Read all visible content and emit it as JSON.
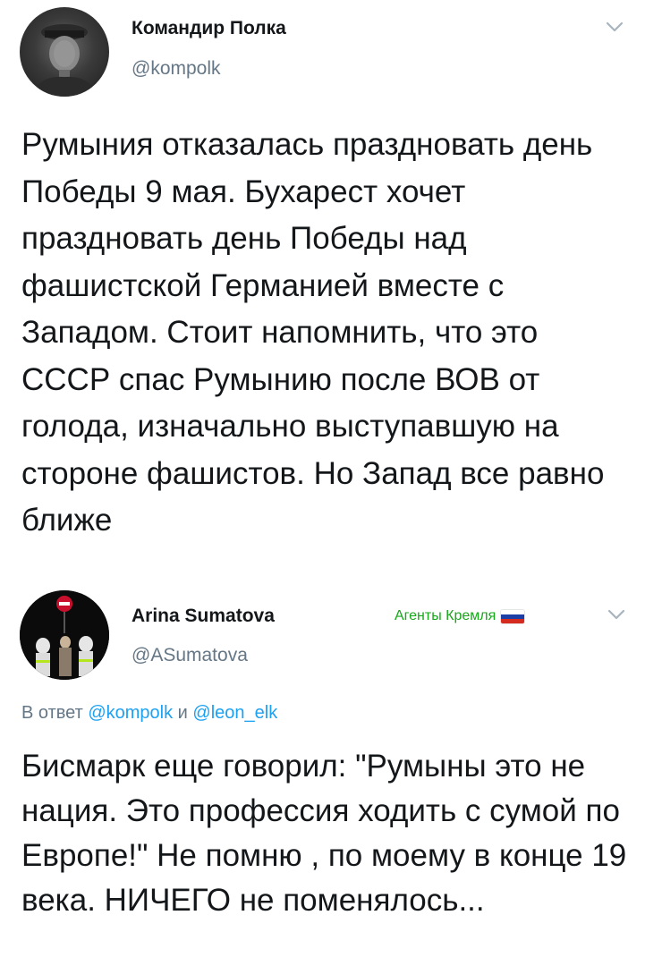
{
  "tweets": [
    {
      "display_name": "Командир Полка",
      "handle": "@kompolk",
      "avatar_icon": "profile-photo",
      "menu_icon": "chevron-down-icon",
      "text": "Румыния отказалась праздновать день Победы 9 мая. Бухарест хочет праздновать день Победы над фашистской Германией вместе с Западом. Стоит напомнить, что это СССР спас Румынию после ВОВ от голода, изначально выступавшую на стороне фашистов. Но Запад все равно ближе"
    },
    {
      "display_name": "Arina Sumatova",
      "handle": "@ASumatova",
      "avatar_icon": "profile-photo",
      "menu_icon": "chevron-down-icon",
      "label": "Агенты Кремля",
      "label_flag": "russian-flag-icon",
      "reply_prefix": "В ответ",
      "reply_user_1": "@kompolk",
      "reply_and": "и",
      "reply_user_2": "@leon_elk",
      "text": "Бисмарк еще говорил: \"Румыны это не нация. Это профессия ходить с сумой по Европе!\" Не помню , по моему в конце 19 века. НИЧЕГО не поменялось..."
    }
  ],
  "colors": {
    "text": "#14171a",
    "secondary": "#657786",
    "link": "#1da1f2",
    "label_green": "#17a81a"
  }
}
